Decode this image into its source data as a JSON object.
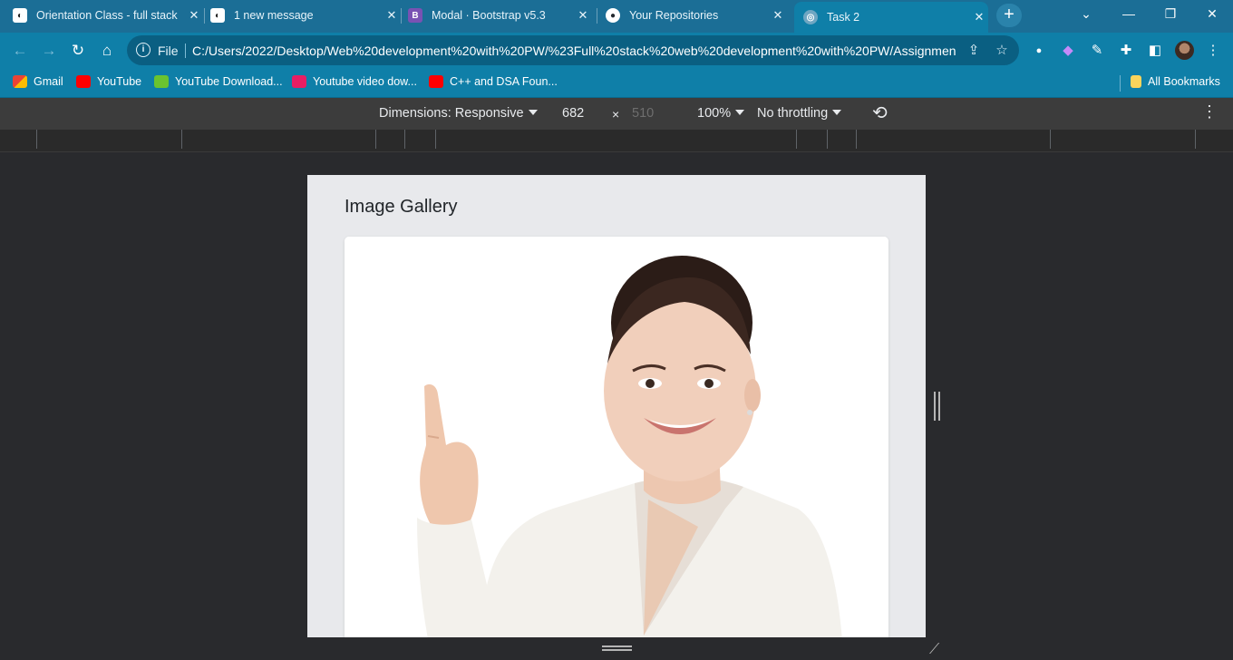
{
  "browser": {
    "tabs": [
      {
        "title": "Orientation Class - full stack",
        "active": false
      },
      {
        "title": "1 new message",
        "active": false
      },
      {
        "title": "Modal · Bootstrap v5.3",
        "active": false
      },
      {
        "title": "Your Repositories",
        "active": false
      },
      {
        "title": "Task 2",
        "active": true
      }
    ],
    "address": {
      "scheme_label": "File",
      "url": "C:/Users/2022/Desktop/Web%20development%20with%20PW/%23Full%20stack%20web%20development%20with%20PW/Assignmen..."
    },
    "bookmarks": [
      {
        "label": "Gmail",
        "color": "#ea4335"
      },
      {
        "label": "YouTube",
        "color": "#ff0000"
      },
      {
        "label": "YouTube Download...",
        "color": "#6ac32f"
      },
      {
        "label": "Youtube video dow...",
        "color": "#e91e63"
      },
      {
        "label": "C++ and DSA Foun...",
        "color": "#ff0000"
      }
    ],
    "all_bookmarks_label": "All Bookmarks",
    "accent_color": "#0f7fa8"
  },
  "devtools": {
    "dimensions_label": "Dimensions: Responsive",
    "width": "682",
    "times": "×",
    "height_placeholder": "510",
    "zoom": "100%",
    "throttling": "No throttling"
  },
  "page": {
    "title": "Image Gallery"
  }
}
